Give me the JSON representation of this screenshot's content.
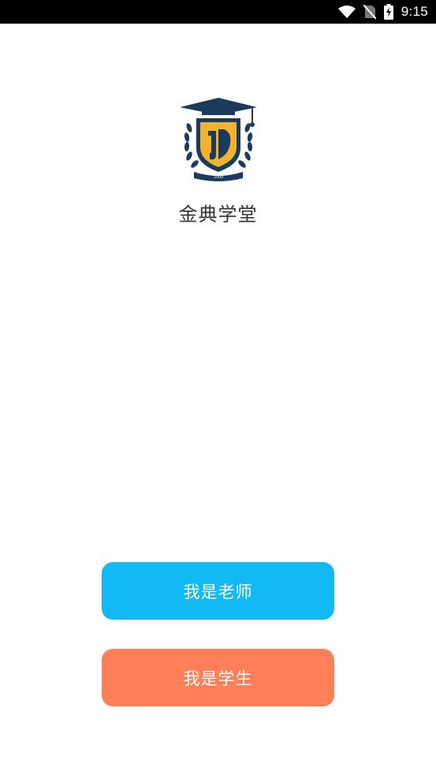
{
  "status_bar": {
    "time": "9:15",
    "icons": [
      "wifi-icon",
      "no-sim-icon",
      "battery-charging-icon"
    ]
  },
  "app": {
    "logo_year": "2008",
    "title": "金典学堂"
  },
  "buttons": {
    "teacher_label": "我是老师",
    "student_label": "我是学生",
    "teacher_color": "#12B9F5",
    "student_color": "#FF7F59"
  },
  "colors": {
    "logo_navy": "#1B3A5C",
    "logo_gold": "#F2B12E"
  }
}
